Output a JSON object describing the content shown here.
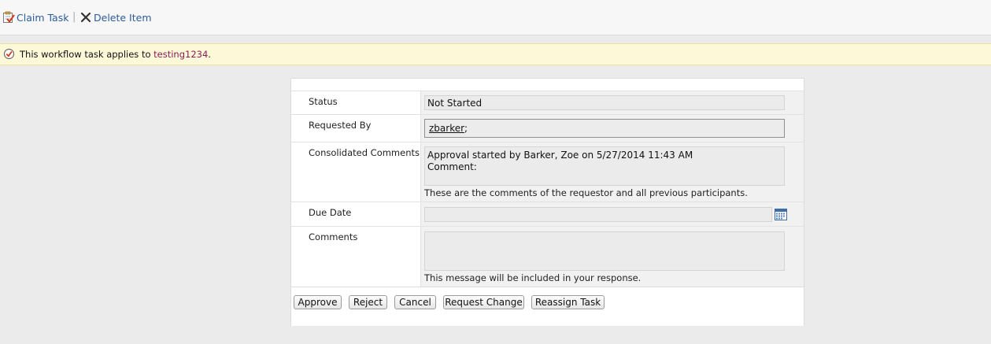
{
  "toolbar": {
    "claim_label": "Claim Task",
    "claim_icon": "claim-task-icon",
    "delete_label": "Delete Item",
    "delete_icon": "delete-x-icon",
    "separator": "|"
  },
  "notice": {
    "icon": "workflow-task-icon",
    "text": "This workflow task applies to ",
    "link_text": "testing1234",
    "suffix": "."
  },
  "form": {
    "status": {
      "label": "Status",
      "value": "Not Started"
    },
    "requested_by": {
      "label": "Requested By",
      "value": "zbarker",
      "suffix": ";"
    },
    "consolidated_comments": {
      "label": "Consolidated Comments",
      "line1": "Approval started by Barker, Zoe on 5/27/2014 11:43 AM",
      "line2": "Comment:",
      "helper": "These are the comments of the requestor and all previous participants."
    },
    "due_date": {
      "label": "Due Date",
      "value": "",
      "picker_icon": "calendar-icon"
    },
    "comments": {
      "label": "Comments",
      "value": "",
      "helper": "This message will be included in your response."
    }
  },
  "buttons": {
    "approve": "Approve",
    "reject": "Reject",
    "cancel": "Cancel",
    "request_change": "Request Change",
    "reassign": "Reassign Task"
  },
  "colors": {
    "link": "#2a5c9a",
    "notice_bg": "#fcf8d8",
    "item_link": "#8c1c5b"
  }
}
